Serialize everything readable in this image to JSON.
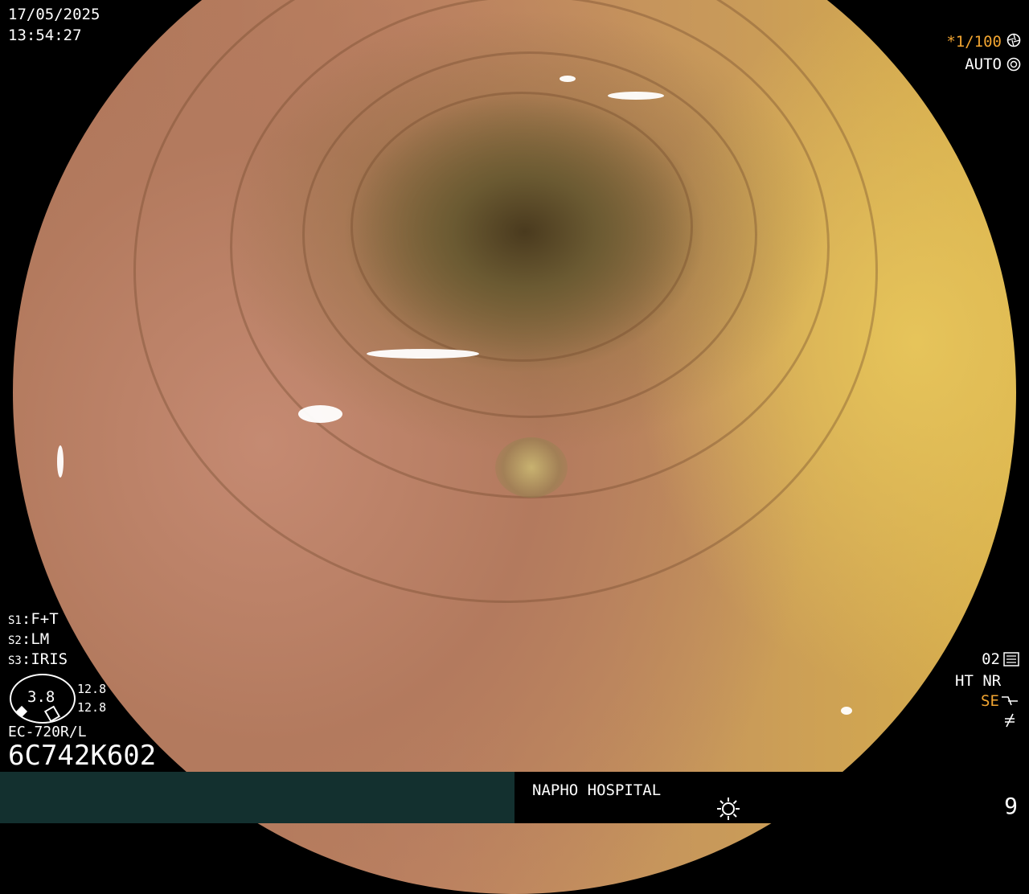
{
  "datetime": {
    "date": "17/05/2025",
    "time": "13:54:27"
  },
  "shutter": {
    "value": "*1/100",
    "icon": "aperture-icon"
  },
  "auto": {
    "label": "AUTO",
    "icon": "iris-icon"
  },
  "settings": {
    "s1_key": "S1",
    "s1_val": "F+T",
    "s2_key": "S2",
    "s2_val": "LM",
    "s3_key": "S3",
    "s3_val": "IRIS"
  },
  "gauge": {
    "value": "3.8",
    "top": "12.8",
    "bottom": "12.8"
  },
  "scope": {
    "model": "EC-720R/L",
    "serial": "6C742K602"
  },
  "modes": {
    "number": "02",
    "ht": "HT",
    "nr": "NR",
    "se": "SE",
    "icon1": "settings-icon",
    "icon2": "curve-icon",
    "icon3": "slash-icon"
  },
  "footer": {
    "hospital": "NAPHO HOSPITAL",
    "count": "9",
    "icon": "sun-icon"
  },
  "colors": {
    "accent": "#f2a531",
    "footer_left": "#13302f"
  }
}
